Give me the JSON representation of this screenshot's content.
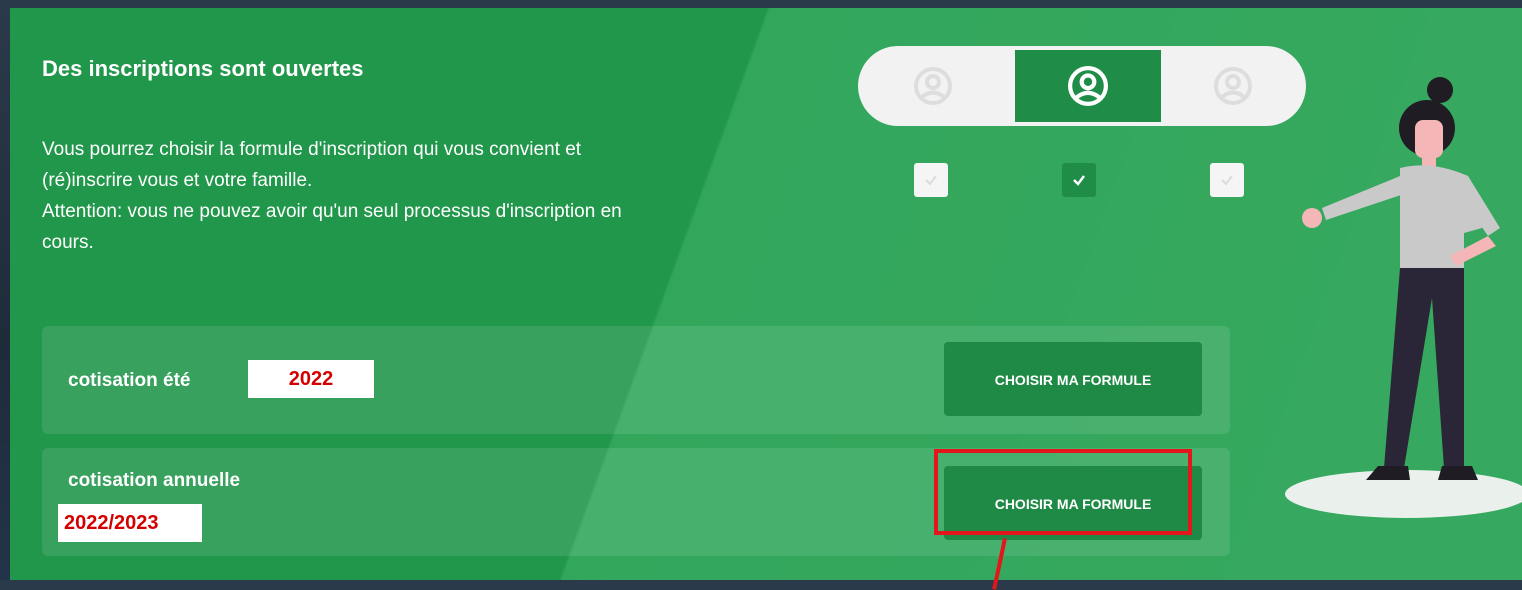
{
  "card": {
    "title": "Des inscriptions sont ouvertes",
    "description": [
      "Vous pourrez choisir la formule d'inscription qui vous convient et",
      "(ré)inscrire vous et votre famille.",
      "Attention: vous ne pouvez avoir qu'un seul processus d'inscription en",
      "cours."
    ]
  },
  "options": [
    {
      "label": "cotisation été",
      "year": "2022",
      "button": "CHOISIR MA FORMULE"
    },
    {
      "label": "cotisation annuelle",
      "year": "2022/2023",
      "button": "CHOISIR MA FORMULE"
    }
  ],
  "stepper": {
    "selected_index": 1,
    "icons": [
      "user-circle-icon",
      "user-circle-icon",
      "user-circle-icon"
    ],
    "check_icon": "check-icon"
  },
  "colors": {
    "card_green": "#23a050",
    "button_green": "#1f8a46",
    "highlight_red": "#e3161b",
    "year_red": "#d40000"
  }
}
